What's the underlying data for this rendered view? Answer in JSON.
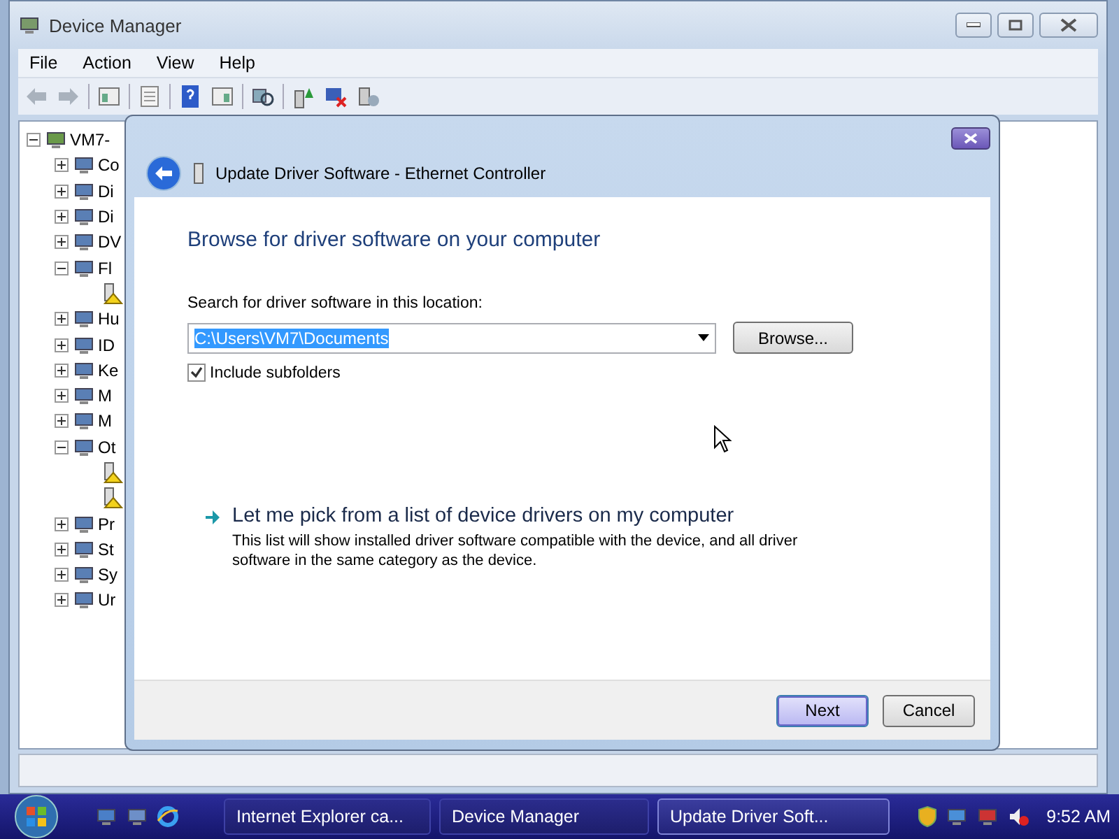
{
  "window": {
    "title": "Device Manager"
  },
  "menu": [
    "File",
    "Action",
    "View",
    "Help"
  ],
  "tree": {
    "label": "VM7-",
    "expanded": true,
    "children": [
      {
        "label": "Co",
        "expanded": false
      },
      {
        "label": "Di",
        "expanded": false
      },
      {
        "label": "Di",
        "expanded": false
      },
      {
        "label": "DV",
        "expanded": false
      },
      {
        "label": "Fl",
        "expanded": true,
        "children": [
          {
            "warning": true
          }
        ]
      },
      {
        "label": "Hu",
        "expanded": false
      },
      {
        "label": "ID",
        "expanded": false
      },
      {
        "label": "Ke",
        "expanded": false
      },
      {
        "label": "M",
        "expanded": false
      },
      {
        "label": "M",
        "expanded": false
      },
      {
        "label": "Ot",
        "expanded": true,
        "children": [
          {
            "warning": true
          },
          {
            "warning": true
          }
        ]
      },
      {
        "label": "Pr",
        "expanded": false
      },
      {
        "label": "St",
        "expanded": false
      },
      {
        "label": "Sy",
        "expanded": false
      },
      {
        "label": "Ur",
        "expanded": false
      }
    ]
  },
  "dialog": {
    "title": "Update Driver Software - Ethernet Controller",
    "heading": "Browse for driver software on your computer",
    "location_label": "Search for driver software in this location:",
    "location_value": "C:\\Users\\VM7\\Documents",
    "value_selected": true,
    "browse_button": "Browse...",
    "include_subfolders": {
      "label": "Include subfolders",
      "checked": true
    },
    "pick_option": {
      "title": "Let me pick from a list of device drivers on my computer",
      "description": "This list will show installed driver software compatible with the device, and all driver software in the same category as the device."
    },
    "buttons": [
      {
        "label": "Next",
        "default": true
      },
      {
        "label": "Cancel",
        "default": false
      }
    ]
  },
  "taskbar": {
    "tasks": [
      {
        "label": "Internet Explorer ca...",
        "selected": false
      },
      {
        "label": "Device Manager",
        "selected": false
      },
      {
        "label": "Update Driver Soft...",
        "selected": true
      }
    ],
    "clock": "9:52 AM"
  }
}
